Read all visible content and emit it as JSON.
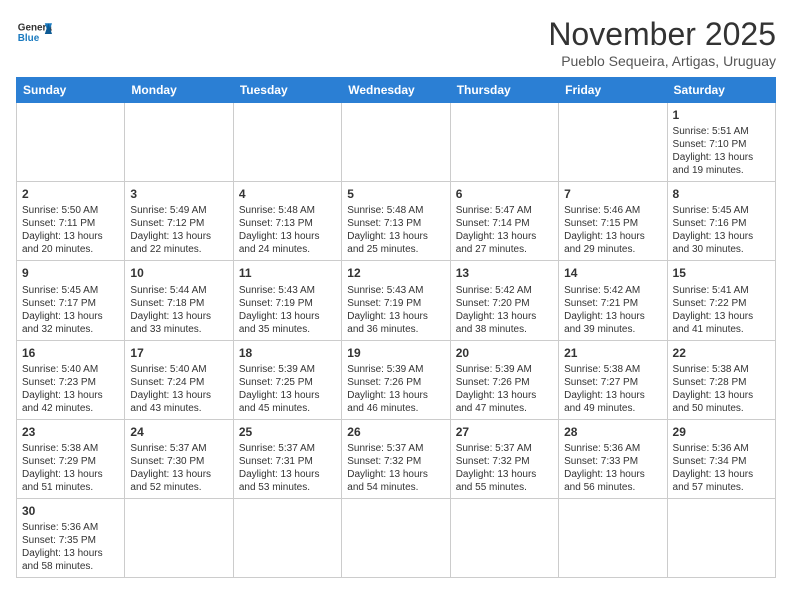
{
  "logo": {
    "text_general": "General",
    "text_blue": "Blue"
  },
  "title": "November 2025",
  "subtitle": "Pueblo Sequeira, Artigas, Uruguay",
  "days_of_week": [
    "Sunday",
    "Monday",
    "Tuesday",
    "Wednesday",
    "Thursday",
    "Friday",
    "Saturday"
  ],
  "weeks": [
    [
      {
        "day": "",
        "info": ""
      },
      {
        "day": "",
        "info": ""
      },
      {
        "day": "",
        "info": ""
      },
      {
        "day": "",
        "info": ""
      },
      {
        "day": "",
        "info": ""
      },
      {
        "day": "",
        "info": ""
      },
      {
        "day": "1",
        "info": "Sunrise: 5:51 AM\nSunset: 7:10 PM\nDaylight: 13 hours and 19 minutes."
      }
    ],
    [
      {
        "day": "2",
        "info": "Sunrise: 5:50 AM\nSunset: 7:11 PM\nDaylight: 13 hours and 20 minutes."
      },
      {
        "day": "3",
        "info": "Sunrise: 5:49 AM\nSunset: 7:12 PM\nDaylight: 13 hours and 22 minutes."
      },
      {
        "day": "4",
        "info": "Sunrise: 5:48 AM\nSunset: 7:13 PM\nDaylight: 13 hours and 24 minutes."
      },
      {
        "day": "5",
        "info": "Sunrise: 5:48 AM\nSunset: 7:13 PM\nDaylight: 13 hours and 25 minutes."
      },
      {
        "day": "6",
        "info": "Sunrise: 5:47 AM\nSunset: 7:14 PM\nDaylight: 13 hours and 27 minutes."
      },
      {
        "day": "7",
        "info": "Sunrise: 5:46 AM\nSunset: 7:15 PM\nDaylight: 13 hours and 29 minutes."
      },
      {
        "day": "8",
        "info": "Sunrise: 5:45 AM\nSunset: 7:16 PM\nDaylight: 13 hours and 30 minutes."
      }
    ],
    [
      {
        "day": "9",
        "info": "Sunrise: 5:45 AM\nSunset: 7:17 PM\nDaylight: 13 hours and 32 minutes."
      },
      {
        "day": "10",
        "info": "Sunrise: 5:44 AM\nSunset: 7:18 PM\nDaylight: 13 hours and 33 minutes."
      },
      {
        "day": "11",
        "info": "Sunrise: 5:43 AM\nSunset: 7:19 PM\nDaylight: 13 hours and 35 minutes."
      },
      {
        "day": "12",
        "info": "Sunrise: 5:43 AM\nSunset: 7:19 PM\nDaylight: 13 hours and 36 minutes."
      },
      {
        "day": "13",
        "info": "Sunrise: 5:42 AM\nSunset: 7:20 PM\nDaylight: 13 hours and 38 minutes."
      },
      {
        "day": "14",
        "info": "Sunrise: 5:42 AM\nSunset: 7:21 PM\nDaylight: 13 hours and 39 minutes."
      },
      {
        "day": "15",
        "info": "Sunrise: 5:41 AM\nSunset: 7:22 PM\nDaylight: 13 hours and 41 minutes."
      }
    ],
    [
      {
        "day": "16",
        "info": "Sunrise: 5:40 AM\nSunset: 7:23 PM\nDaylight: 13 hours and 42 minutes."
      },
      {
        "day": "17",
        "info": "Sunrise: 5:40 AM\nSunset: 7:24 PM\nDaylight: 13 hours and 43 minutes."
      },
      {
        "day": "18",
        "info": "Sunrise: 5:39 AM\nSunset: 7:25 PM\nDaylight: 13 hours and 45 minutes."
      },
      {
        "day": "19",
        "info": "Sunrise: 5:39 AM\nSunset: 7:26 PM\nDaylight: 13 hours and 46 minutes."
      },
      {
        "day": "20",
        "info": "Sunrise: 5:39 AM\nSunset: 7:26 PM\nDaylight: 13 hours and 47 minutes."
      },
      {
        "day": "21",
        "info": "Sunrise: 5:38 AM\nSunset: 7:27 PM\nDaylight: 13 hours and 49 minutes."
      },
      {
        "day": "22",
        "info": "Sunrise: 5:38 AM\nSunset: 7:28 PM\nDaylight: 13 hours and 50 minutes."
      }
    ],
    [
      {
        "day": "23",
        "info": "Sunrise: 5:38 AM\nSunset: 7:29 PM\nDaylight: 13 hours and 51 minutes."
      },
      {
        "day": "24",
        "info": "Sunrise: 5:37 AM\nSunset: 7:30 PM\nDaylight: 13 hours and 52 minutes."
      },
      {
        "day": "25",
        "info": "Sunrise: 5:37 AM\nSunset: 7:31 PM\nDaylight: 13 hours and 53 minutes."
      },
      {
        "day": "26",
        "info": "Sunrise: 5:37 AM\nSunset: 7:32 PM\nDaylight: 13 hours and 54 minutes."
      },
      {
        "day": "27",
        "info": "Sunrise: 5:37 AM\nSunset: 7:32 PM\nDaylight: 13 hours and 55 minutes."
      },
      {
        "day": "28",
        "info": "Sunrise: 5:36 AM\nSunset: 7:33 PM\nDaylight: 13 hours and 56 minutes."
      },
      {
        "day": "29",
        "info": "Sunrise: 5:36 AM\nSunset: 7:34 PM\nDaylight: 13 hours and 57 minutes."
      }
    ],
    [
      {
        "day": "30",
        "info": "Sunrise: 5:36 AM\nSunset: 7:35 PM\nDaylight: 13 hours and 58 minutes."
      },
      {
        "day": "",
        "info": ""
      },
      {
        "day": "",
        "info": ""
      },
      {
        "day": "",
        "info": ""
      },
      {
        "day": "",
        "info": ""
      },
      {
        "day": "",
        "info": ""
      },
      {
        "day": "",
        "info": ""
      }
    ]
  ]
}
